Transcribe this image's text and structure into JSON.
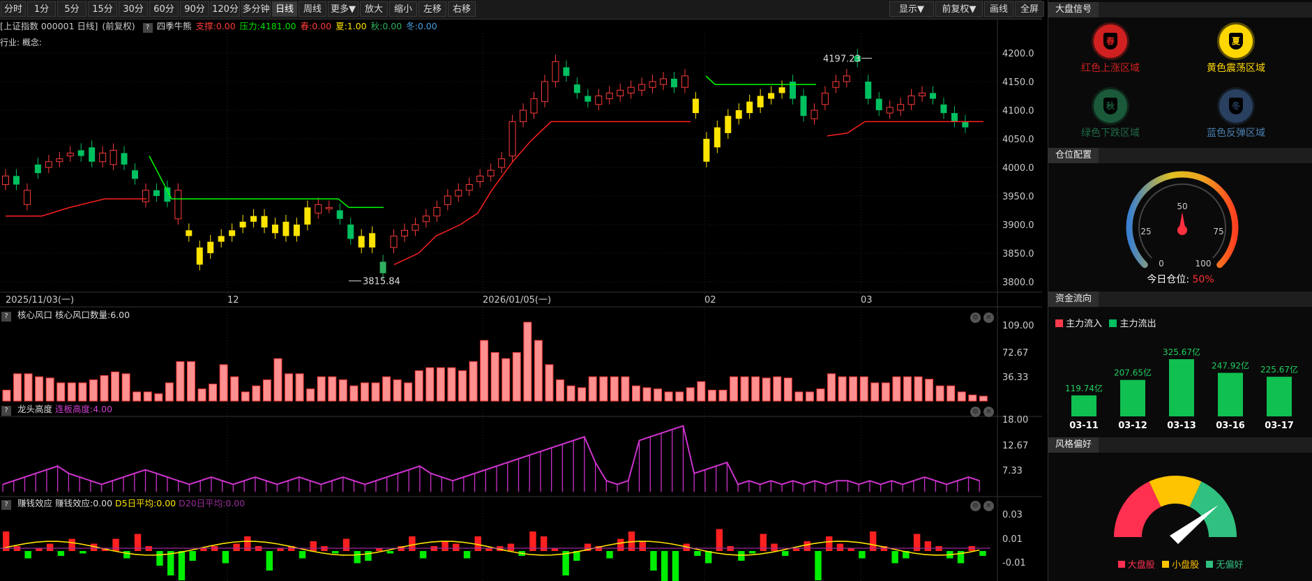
{
  "toolbar": {
    "periods": [
      "分时",
      "1分",
      "5分",
      "15分",
      "30分",
      "60分",
      "90分",
      "120分",
      "多分钟",
      "日线",
      "周线",
      "更多▼",
      "放大",
      "缩小",
      "左移",
      "右移"
    ],
    "right_buttons": [
      "显示▼",
      "前复权▼",
      "画线",
      "全屏"
    ]
  },
  "info": {
    "name": "[上证指数 000001 日线]",
    "adj": "(前复权)",
    "indicator": "四季牛熊",
    "support": "支撑:0.00",
    "pressure": "压力:4181.00",
    "spring": "春:0.00",
    "summer": "夏:1.00",
    "autumn": "秋:0.00",
    "winter": "冬:0.00",
    "industry": "行业: 概念:"
  },
  "colors": {
    "up": "#ff3b3b",
    "down": "#00c060",
    "yellow": "#ffe400",
    "green_line": "#00ff00",
    "magenta": "#cc33cc",
    "accent_red": "#ff4040"
  },
  "main_chart": {
    "y_ticks": [
      "4200.0",
      "4150.0",
      "4100.0",
      "4050.0",
      "4000.0",
      "3950.0",
      "3900.0",
      "3850.0",
      "3800.0"
    ],
    "x_labels": [
      "2025/11/03(一)",
      "12",
      "2026/01/05(一)",
      "02",
      "03"
    ],
    "high_label": "4197.23",
    "low_label": "3815.84"
  },
  "chart_data": [
    {
      "type": "bar",
      "title": "核心风口",
      "legend": "核心风口数量:6.00",
      "yticks": [
        "109.00",
        "72.67",
        "36.33"
      ],
      "ylim": [
        0,
        109
      ],
      "values": [
        18,
        45,
        45,
        40,
        38,
        30,
        30,
        30,
        35,
        42,
        48,
        45,
        15,
        15,
        12,
        30,
        65,
        65,
        20,
        28,
        60,
        40,
        15,
        25,
        35,
        70,
        45,
        45,
        20,
        40,
        40,
        35,
        25,
        30,
        30,
        40,
        35,
        30,
        50,
        55,
        55,
        55,
        50,
        65,
        100,
        80,
        70,
        80,
        130,
        100,
        60,
        35,
        25,
        22,
        40,
        40,
        40,
        40,
        25,
        22,
        20,
        15,
        15,
        22,
        32,
        18,
        18,
        40,
        40,
        40,
        38,
        40,
        38,
        15,
        15,
        20,
        45,
        40,
        40,
        40,
        30,
        30,
        40,
        40,
        40,
        36,
        25,
        25,
        15,
        10,
        8
      ],
      "value_note": "heights as percent of range"
    },
    {
      "type": "line",
      "title": "龙头高度",
      "legend": "连板高度:4.00",
      "yticks": [
        "18.00",
        "12.67",
        "7.33"
      ],
      "ylim": [
        0,
        20
      ]
    },
    {
      "type": "bar",
      "title": "赚钱效应",
      "legend": "赚钱效应:0.00",
      "legend2": "D5日平均:0.00",
      "legend3": "D20日平均:0.00",
      "yticks": [
        "0.03",
        "0.01",
        "-0.01"
      ]
    }
  ],
  "right": {
    "market_signal": "大盘信号",
    "seasons": [
      {
        "name": "红色上涨区域",
        "glyph": "春",
        "color": "#d02020"
      },
      {
        "name": "黄色震荡区域",
        "glyph": "夏",
        "color": "#ffd700"
      },
      {
        "name": "绿色下跌区域",
        "glyph": "秋",
        "color": "#1a5a3a"
      },
      {
        "name": "蓝色反弹区域",
        "glyph": "冬",
        "color": "#2a4060"
      }
    ],
    "position_title": "仓位配置",
    "gauge": {
      "labels": [
        "0",
        "25",
        "50",
        "75",
        "100"
      ],
      "today_label": "今日仓位:",
      "today_value": "50%",
      "value": 50
    },
    "money_title": "资金流向",
    "money_legend": [
      "主力流入",
      "主力流出"
    ],
    "money_bars": [
      {
        "date": "03-11",
        "label": "119.74亿",
        "value": 119.74
      },
      {
        "date": "03-12",
        "label": "207.65亿",
        "value": 207.65
      },
      {
        "date": "03-13",
        "label": "325.67亿",
        "value": 325.67
      },
      {
        "date": "03-16",
        "label": "247.92亿",
        "value": 247.92
      },
      {
        "date": "03-17",
        "label": "225.67亿",
        "value": 225.67
      }
    ],
    "style_title": "风格偏好",
    "style_legend": [
      "大盘股",
      "小盘股",
      "无偏好"
    ]
  }
}
